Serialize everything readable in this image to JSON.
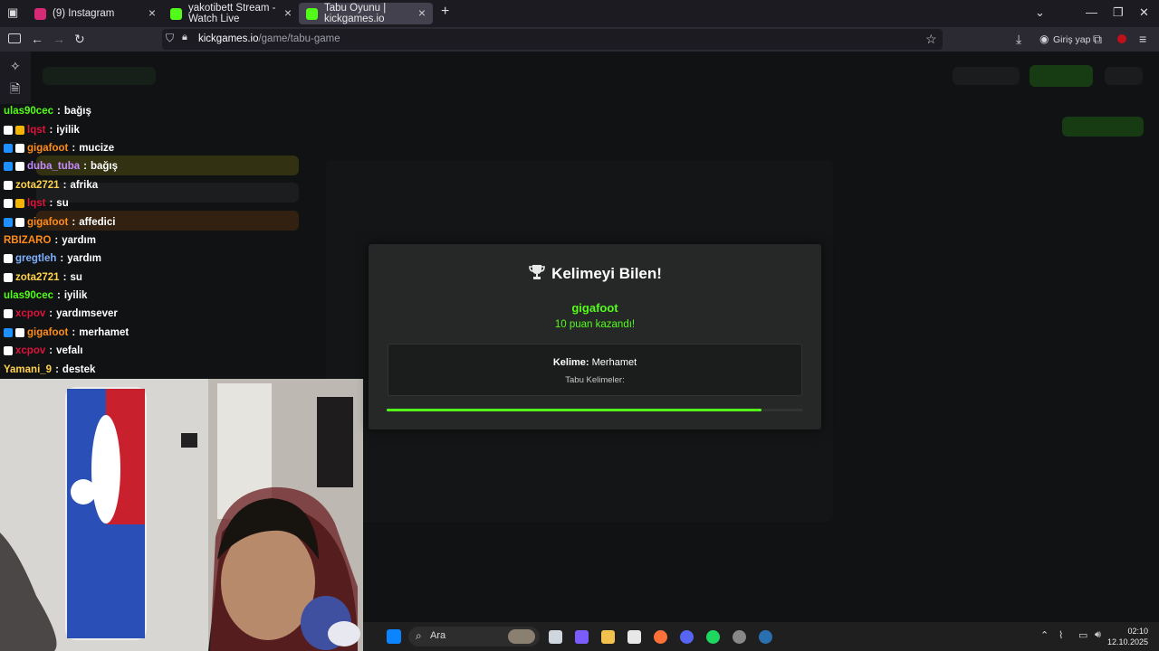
{
  "browser": {
    "tabs": [
      {
        "label": "(9) Instagram",
        "favicon_color": "#d62976"
      },
      {
        "label": "yakotibett Stream - Watch Live",
        "favicon_color": "#53fc18"
      },
      {
        "label": "Tabu Oyunu | kickgames.io",
        "favicon_color": "#53fc18"
      }
    ],
    "new_tab": "+",
    "url_host": "kickgames.io",
    "url_path": "/game/tabu-game",
    "sign_in": "Giriş yap"
  },
  "chat": [
    {
      "user": "ulas90cec",
      "user_color": "#53fc18",
      "badges": [],
      "text": "bağış"
    },
    {
      "user": "lqst",
      "user_color": "#e0123c",
      "badges": [
        "#ffffff",
        "#f5b400"
      ],
      "text": "iyilik"
    },
    {
      "user": "gigafoot",
      "user_color": "#ff8c1a",
      "badges": [
        "#1e90ff",
        "#ffffff"
      ],
      "text": "mucize"
    },
    {
      "user": "duba_tuba",
      "user_color": "#c58bff",
      "badges": [
        "#1e90ff",
        "#ffffff"
      ],
      "text": "bağış"
    },
    {
      "user": "zota2721",
      "user_color": "#ffd24a",
      "badges": [
        "#ffffff"
      ],
      "text": "afrika"
    },
    {
      "user": "lqst",
      "user_color": "#e0123c",
      "badges": [
        "#ffffff",
        "#f5b400"
      ],
      "text": "su"
    },
    {
      "user": "gigafoot",
      "user_color": "#ff8c1a",
      "badges": [
        "#1e90ff",
        "#ffffff"
      ],
      "text": "affedici"
    },
    {
      "user": "RBIZARO",
      "user_color": "#ff8c1a",
      "badges": [],
      "text": "yardım"
    },
    {
      "user": "gregtleh",
      "user_color": "#7fb0ff",
      "badges": [
        "#ffffff"
      ],
      "text": "yardım"
    },
    {
      "user": "zota2721",
      "user_color": "#ffd24a",
      "badges": [
        "#ffffff"
      ],
      "text": "su"
    },
    {
      "user": "ulas90cec",
      "user_color": "#53fc18",
      "badges": [],
      "text": "iyilik"
    },
    {
      "user": "xcpov",
      "user_color": "#e0123c",
      "badges": [
        "#ffffff"
      ],
      "text": "yardımsever"
    },
    {
      "user": "gigafoot",
      "user_color": "#ff8c1a",
      "badges": [
        "#1e90ff",
        "#ffffff"
      ],
      "text": "merhamet"
    },
    {
      "user": "xcpov",
      "user_color": "#e0123c",
      "badges": [
        "#ffffff"
      ],
      "text": "vefalı"
    },
    {
      "user": "Yamani_9",
      "user_color": "#ffd24a",
      "badges": [],
      "text": "destek"
    }
  ],
  "modal": {
    "title": "Kelimeyi Bilen!",
    "winner": "gigafoot",
    "points_text": "10 puan kazandı!",
    "word_label": "Kelime:",
    "word": "Merhamet",
    "taboo_label": "Tabu Kelimeler:",
    "progress": 0.9
  },
  "taskbar": {
    "search_placeholder": "Ara",
    "time": "02:10",
    "date": "12.10.2025"
  },
  "colors": {
    "accent": "#53fc18"
  }
}
